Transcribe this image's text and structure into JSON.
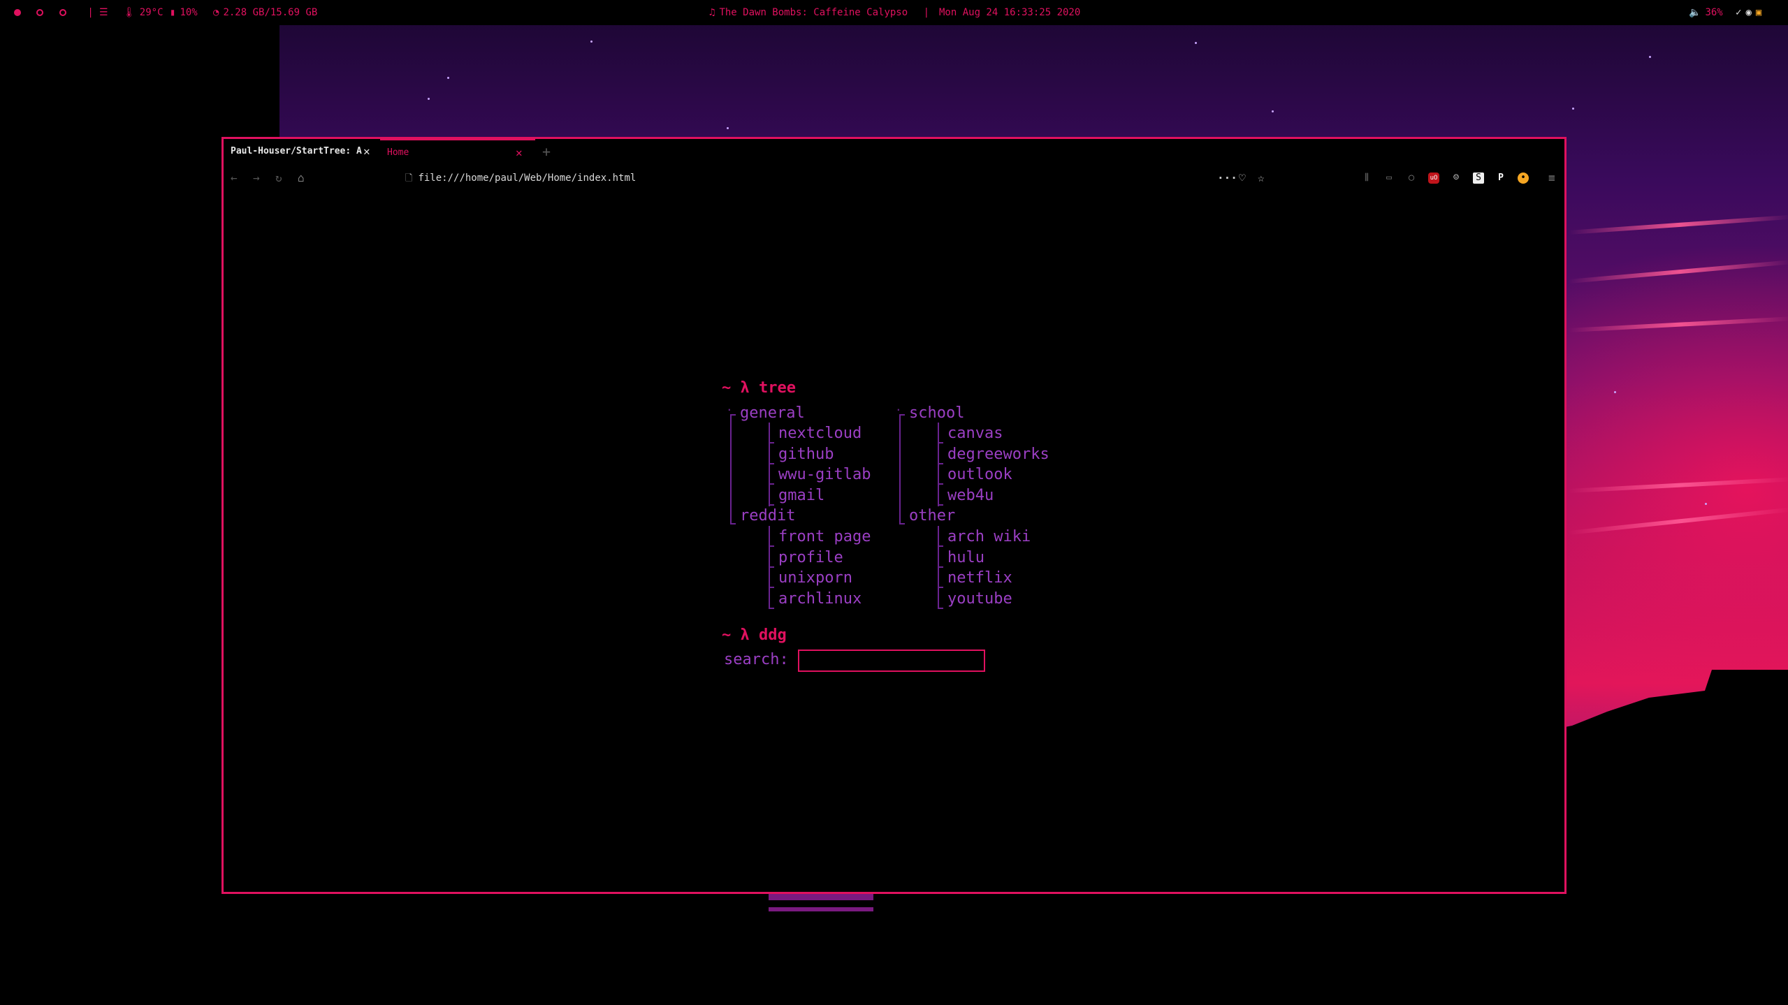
{
  "statusbar": {
    "temperature": "29°C",
    "cpu": "10%",
    "memory": "2.28 GB/15.69 GB",
    "now_playing": "The Dawn Bombs: Caffeine Calypso",
    "separator": "|",
    "datetime": "Mon Aug 24 16:33:25 2020",
    "volume": "36%"
  },
  "browser": {
    "tabs": [
      {
        "title": "Paul-Houser/StartTree: A",
        "active": false
      },
      {
        "title": "Home",
        "active": true
      }
    ],
    "url": "file:///home/paul/Web/Home/index.html",
    "toolbar_icons": [
      "library-icon",
      "sidebar-icon",
      "account-icon",
      "ublock-icon",
      "ghost-icon",
      "steam-icon",
      "p-extension-icon",
      "cookie-icon",
      "menu-icon"
    ]
  },
  "page": {
    "tree_prompt": "~ λ tree",
    "ddg_prompt": "~ λ ddg",
    "search_label": "search:",
    "search_value": "",
    "columns": [
      {
        "groups": [
          {
            "name": "general",
            "links": [
              "nextcloud",
              "github",
              "wwu-gitlab",
              "gmail"
            ]
          },
          {
            "name": "reddit",
            "links": [
              "front page",
              "profile",
              "unixporn",
              "archlinux"
            ]
          }
        ]
      },
      {
        "groups": [
          {
            "name": "school",
            "links": [
              "canvas",
              "degreeworks",
              "outlook",
              "web4u"
            ]
          },
          {
            "name": "other",
            "links": [
              "arch wiki",
              "hulu",
              "netflix",
              "youtube"
            ]
          }
        ]
      }
    ]
  },
  "colors": {
    "accent": "#e0115f",
    "link": "#9b3fc4",
    "tree_line": "#6a2390"
  }
}
